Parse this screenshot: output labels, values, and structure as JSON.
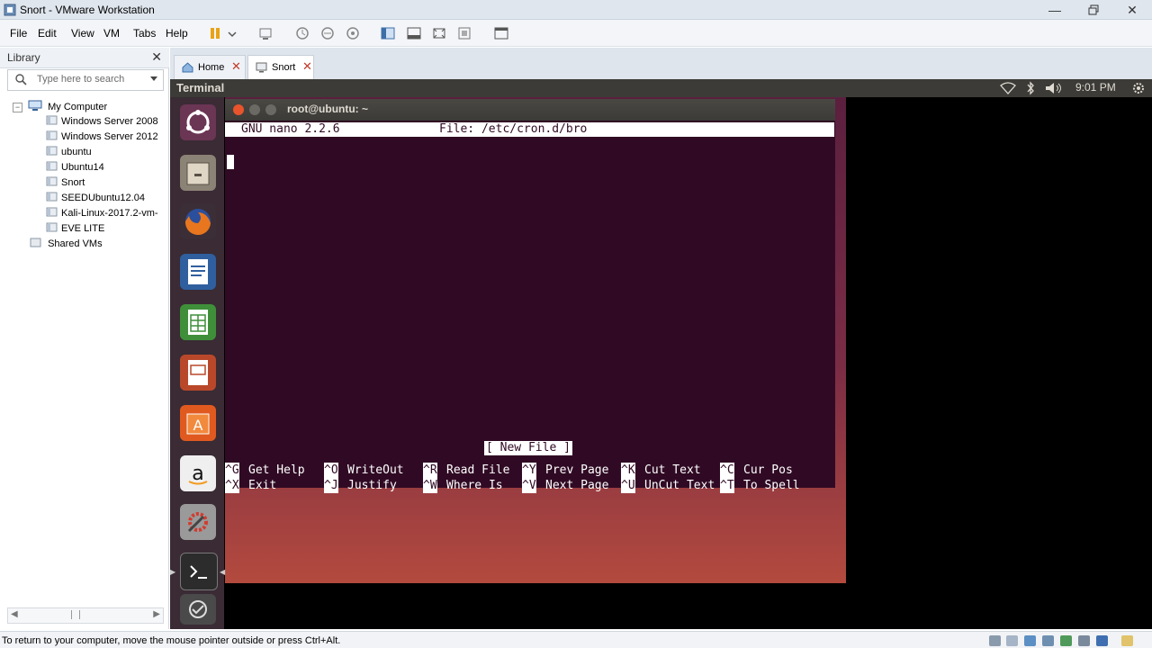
{
  "window": {
    "title": "Snort - VMware Workstation"
  },
  "menu": [
    "File",
    "Edit",
    "View",
    "VM",
    "Tabs",
    "Help"
  ],
  "library": {
    "title": "Library",
    "search_placeholder": "Type here to search",
    "root": "My Computer",
    "vms": [
      "Windows Server 2008",
      "Windows Server 2012",
      "ubuntu",
      "Ubuntu14",
      "Snort",
      "SEEDUbuntu12.04",
      "Kali-Linux-2017.2-vm-",
      "EVE LITE"
    ],
    "shared": "Shared VMs"
  },
  "tabs": [
    {
      "label": "Home",
      "active": false
    },
    {
      "label": "Snort",
      "active": true
    }
  ],
  "guest": {
    "panel_title": "Terminal",
    "clock": "9:01 PM"
  },
  "terminal": {
    "title": "root@ubuntu: ~",
    "nano_version": "GNU nano 2.2.6",
    "file": "File: /etc/cron.d/bro",
    "status": "[ New File ]",
    "shortcuts_row1": [
      {
        "key": "^G",
        "label": "Get Help"
      },
      {
        "key": "^O",
        "label": "WriteOut"
      },
      {
        "key": "^R",
        "label": "Read File"
      },
      {
        "key": "^Y",
        "label": "Prev Page"
      },
      {
        "key": "^K",
        "label": "Cut Text"
      },
      {
        "key": "^C",
        "label": "Cur Pos"
      }
    ],
    "shortcuts_row2": [
      {
        "key": "^X",
        "label": "Exit"
      },
      {
        "key": "^J",
        "label": "Justify"
      },
      {
        "key": "^W",
        "label": "Where Is"
      },
      {
        "key": "^V",
        "label": "Next Page"
      },
      {
        "key": "^U",
        "label": "UnCut Text"
      },
      {
        "key": "^T",
        "label": "To Spell"
      }
    ]
  },
  "statusbar": {
    "message": "To return to your computer, move the mouse pointer outside or press Ctrl+Alt."
  },
  "colors": {
    "terminal_bg": "#300a24",
    "panel": "#3c3b37",
    "accent_orange": "#e95420"
  }
}
